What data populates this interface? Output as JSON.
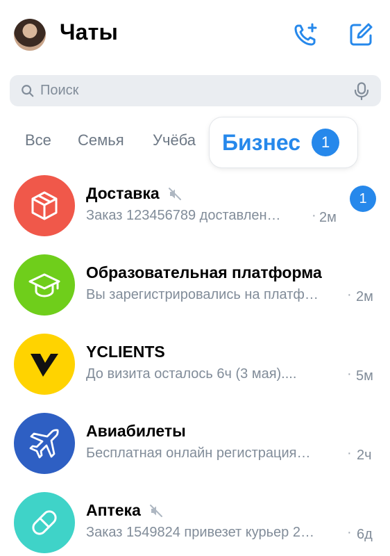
{
  "header": {
    "title": "Чаты",
    "icons": {
      "avatar": "user-avatar",
      "call": "phone-plus-icon",
      "compose": "compose-icon"
    }
  },
  "search": {
    "placeholder": "Поиск"
  },
  "tabs": {
    "items": [
      {
        "label": "Все"
      },
      {
        "label": "Семья"
      },
      {
        "label": "Учёба"
      }
    ],
    "active": {
      "label": "Бизнес",
      "count": "1"
    }
  },
  "colors": {
    "accent": "#2688eb",
    "secondary_text": "#818c99",
    "search_bg": "#eaedf1"
  },
  "chats": [
    {
      "name": "Доставка",
      "muted": true,
      "message": "Заказ 123456789 доставлен…",
      "time": "2м",
      "unread": "1",
      "avatar_color": "#f0584a",
      "icon": "package-icon"
    },
    {
      "name": "Образовательная платформа",
      "muted": false,
      "message": "Вы зарегистрировались на платф…",
      "time": "2м",
      "avatar_color": "#6fce1b",
      "icon": "graduation-cap-icon"
    },
    {
      "name": "YCLIENTS",
      "muted": false,
      "message": "До визита осталось 6ч (3 мая)....",
      "time": "5м",
      "avatar_color": "#ffd300",
      "icon": "yclients-logo-icon"
    },
    {
      "name": "Авиабилеты",
      "muted": false,
      "message": "Бесплатная онлайн регистрация…",
      "time": "2ч",
      "avatar_color": "#2e5fc3",
      "icon": "airplane-icon"
    },
    {
      "name": "Аптека",
      "muted": true,
      "message": "Заказ 1549824 привезет курьер 2…",
      "time": "6д",
      "avatar_color": "#3fd3c8",
      "icon": "pill-icon"
    }
  ]
}
